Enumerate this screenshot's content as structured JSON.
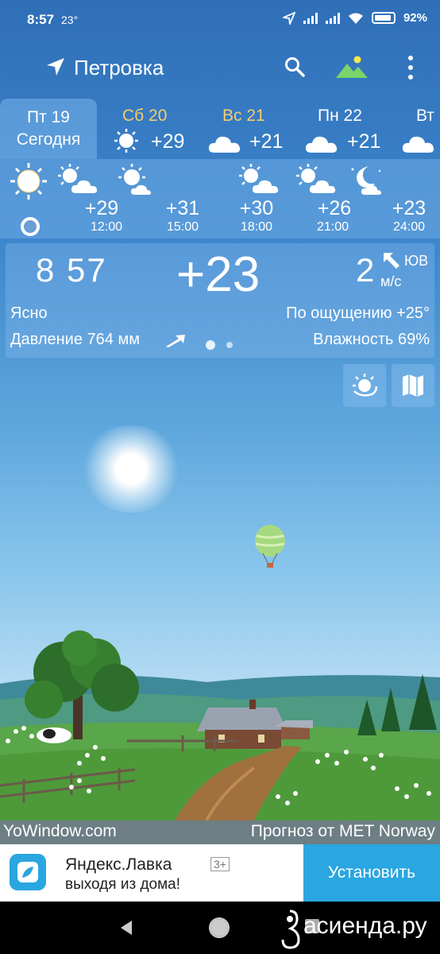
{
  "status_bar": {
    "time": "8:57",
    "temp": "23°",
    "battery": "92%",
    "battery_fraction": 0.92
  },
  "toolbar": {
    "location": "Петровка",
    "icons": [
      "location-arrow-icon",
      "search-icon",
      "landscape-icon",
      "more-vert-icon"
    ]
  },
  "days": [
    {
      "name": "Пт 19",
      "label": "Сегодня",
      "selected": true
    },
    {
      "name": "Сб 20",
      "temp": "+29",
      "icon": "sun-icon",
      "weekend": true
    },
    {
      "name": "Вс 21",
      "temp": "+21",
      "icon": "cloud-icon",
      "weekend": true
    },
    {
      "name": "Пн 22",
      "temp": "+21",
      "icon": "cloud-icon"
    },
    {
      "name": "Вт",
      "icon": "cloud-icon"
    }
  ],
  "hourly": [
    {
      "time": "",
      "temp": "",
      "icon": "sun-icon"
    },
    {
      "time": "12:00",
      "temp": "+29",
      "icon": "sun-cloud-icon"
    },
    {
      "time": "15:00",
      "temp": "+31",
      "icon": "sun-cloud-icon"
    },
    {
      "time": "18:00",
      "temp": "+30",
      "icon": "sun-cloud-icon"
    },
    {
      "time": "21:00",
      "temp": "+26",
      "icon": "sun-cloud-icon"
    },
    {
      "time": "24:00",
      "temp": "+23",
      "icon": "moon-cloud-icon"
    }
  ],
  "current": {
    "clock": "8 57",
    "temp": "+23",
    "wind_speed": "2",
    "wind_unit": "м/с",
    "wind_dir": "ЮВ",
    "condition": "Ясно",
    "feels_like": "По ощущению +25°",
    "pressure": "Давление 764 мм",
    "humidity": "Влажность 69%"
  },
  "credits": {
    "left": "YoWindow.com",
    "right": "Прогноз от MET Norway"
  },
  "ad": {
    "title": "Яндекс.Лавка",
    "age": "3+",
    "subtitle": "выходя из дома!",
    "button": "Установить"
  },
  "watermark": "асиенда.ру",
  "colors": {
    "accent_yellow": "#f4cd6a",
    "ad_blue": "#2aa6e0"
  }
}
